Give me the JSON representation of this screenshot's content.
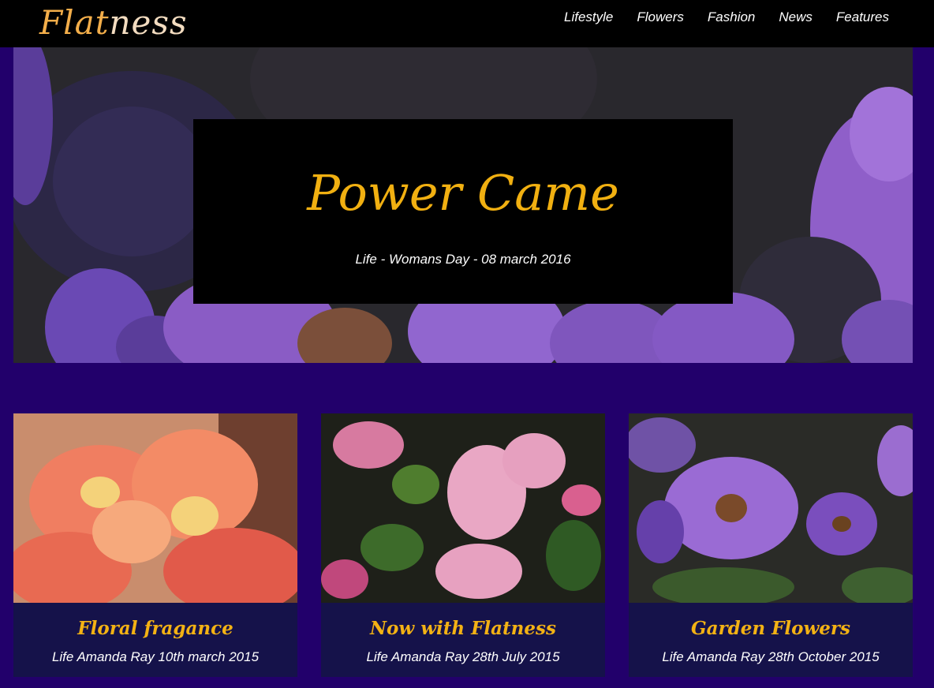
{
  "header": {
    "logo_part1": "Flat",
    "logo_part2": "ness",
    "nav": [
      "Lifestyle",
      "Flowers",
      "Fashion",
      "News",
      "Features"
    ]
  },
  "hero": {
    "title": "Power Came",
    "meta": "Life - Womans Day - 08 march 2016"
  },
  "cards": [
    {
      "title": "Floral fragance",
      "meta": "Life Amanda Ray 10th march 2015"
    },
    {
      "title": "Now with Flatness",
      "meta": "Life Amanda Ray 28th July 2015"
    },
    {
      "title": "Garden Flowers",
      "meta": "Life Amanda Ray 28th October 2015"
    }
  ],
  "colors": {
    "page_bg": "#22006b",
    "accent": "#f1b011",
    "card_bg": "#15124a"
  }
}
